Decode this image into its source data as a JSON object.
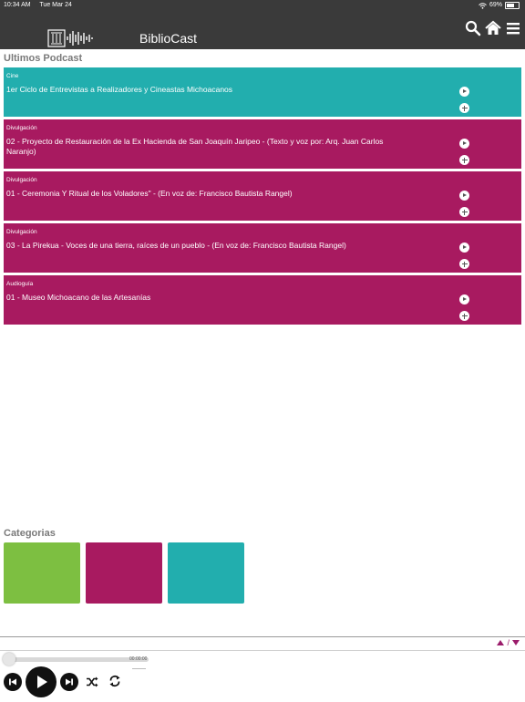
{
  "status_bar": {
    "time": "10:34 AM",
    "date": "Tue Mar 24",
    "battery": "69%"
  },
  "header": {
    "title": "BiblioCast"
  },
  "latest": {
    "heading": "Ultimos Podcast",
    "items": [
      {
        "category": "Cine",
        "title": "1er Ciclo de Entrevistas a Realizadores y Cineastas Michoacanos",
        "color": "#22aeae"
      },
      {
        "category": "Divulgación",
        "title": "02 - Proyecto de Restauración de la Ex Hacienda de San Joaquín Jaripeo - (Texto y voz por: Arq. Juan Carlos Naranjo)",
        "color": "#a81a60"
      },
      {
        "category": "Divulgación",
        "title": "01 - Ceremonia Y Ritual de los Voladores\" - (En voz de: Francisco Bautista Rangel)",
        "color": "#a81a60"
      },
      {
        "category": "Divulgación",
        "title": "03 - La Pirekua - Voces de una tierra, raíces de un pueblo - (En voz de: Francisco Bautista Rangel)",
        "color": "#a81a60"
      },
      {
        "category": "Audioguía",
        "title": "01 - Museo Michoacano de las Artesanías",
        "color": "#a81a60"
      }
    ]
  },
  "categories": {
    "heading": "Categorias",
    "tiles": [
      {
        "color": "#7dbf41"
      },
      {
        "color": "#a81a60"
      },
      {
        "color": "#22aeae"
      }
    ]
  },
  "player": {
    "time": "00:00:00",
    "expand_separator": "/"
  },
  "colors": {
    "header_bg": "#3a3a3a",
    "accent": "#9b1c6b"
  },
  "icons": {
    "search": "search-icon",
    "home": "home-icon",
    "menu": "menu-icon",
    "play": "play-icon",
    "add": "plus-icon",
    "prev": "previous-icon",
    "next": "next-icon",
    "shuffle": "shuffle-icon",
    "repeat": "repeat-icon"
  }
}
